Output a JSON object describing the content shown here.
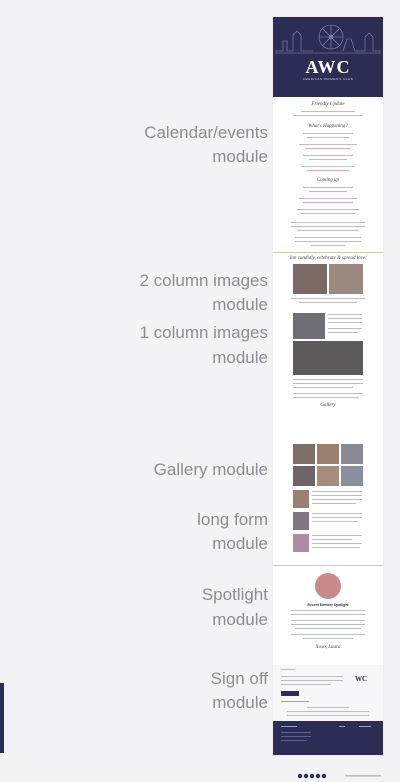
{
  "labels": [
    {
      "text": "Calendar/events"
    },
    {
      "text": "module"
    },
    {
      "text": "2 column images"
    },
    {
      "text": "module"
    },
    {
      "text": "1 column images"
    },
    {
      "text": "module"
    },
    {
      "text": "Gallery module"
    },
    {
      "text": "long form"
    },
    {
      "text": "module"
    },
    {
      "text": "Spotlight"
    },
    {
      "text": "module"
    },
    {
      "text": "Sign off"
    },
    {
      "text": "module"
    }
  ],
  "email": {
    "logo": "AWC",
    "logo_sub": "AMERICAN WOMEN'S CLUB",
    "greeting": "Friendly Update",
    "whats_happening": "What's Happening?",
    "coming_up": "Coming up",
    "section_images": "Jan candidly, celebrate & spread love!",
    "gallery_title": "Gallery",
    "spotlight_title": "Recent Member Spotlight",
    "sign_off": "Xoxo, Laura"
  },
  "colors": {
    "navy": "#2b2d55",
    "pink": "#d85a8a",
    "gold": "#d8c9a7"
  }
}
